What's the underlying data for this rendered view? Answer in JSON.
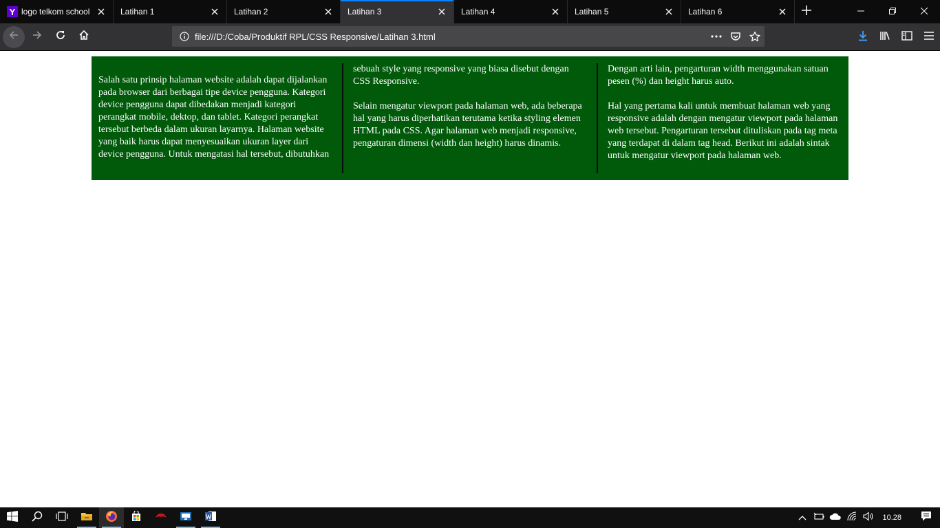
{
  "browser": {
    "tabs": [
      {
        "title": "logo telkom school",
        "favicon": "Y",
        "active": false
      },
      {
        "title": "Latihan 1",
        "active": false
      },
      {
        "title": "Latihan 2",
        "active": false
      },
      {
        "title": "Latihan 3",
        "active": true
      },
      {
        "title": "Latihan 4",
        "active": false
      },
      {
        "title": "Latihan 5",
        "active": false
      },
      {
        "title": "Latihan 6",
        "active": false
      }
    ],
    "url": "file:///D:/Coba/Produktif RPL/CSS Responsive/Latihan 3.html",
    "accent_color": "#0a84ff"
  },
  "page": {
    "background_color": "#005a0a",
    "paragraphs": [
      "Salah satu prinsip halaman website adalah dapat dijalankan pada browser dari berbagai tipe device pengguna. Kategori device pengguna dapat dibedakan menjadi kategori perangkat mobile, dektop, dan tablet. Kategori perangkat tersebut berbeda dalam ukuran layarnya. Halaman website yang baik harus dapat menyesuaikan ukuran layer dari device pengguna. Untuk mengatasi hal tersebut, dibutuhkan sebuah style yang responsive yang biasa disebut dengan CSS Responsive.",
      "Selain mengatur viewport pada halaman web, ada beberapa hal yang harus diperhatikan terutama ketika styling elemen HTML pada CSS. Agar halaman web menjadi responsive, pengaturan dimensi (width dan height) harus dinamis. Dengan arti lain, pengarturan width menggunakan satuan pesen (%) dan height harus auto.",
      "Hal yang pertama kali untuk membuat halaman web yang responsive adalah dengan mengatur viewport pada halaman web tersebut. Pengarturan tersebut dituliskan pada tag meta yang terdapat di dalam tag head. Berikut ini adalah sintak untuk mengatur viewport pada halaman web."
    ]
  },
  "taskbar": {
    "clock": "10.28",
    "pinned": [
      "start-icon",
      "search-icon",
      "task-view-icon",
      "file-explorer-icon",
      "firefox-icon",
      "store-icon",
      "game-icon",
      "media-icon",
      "word-icon"
    ]
  }
}
